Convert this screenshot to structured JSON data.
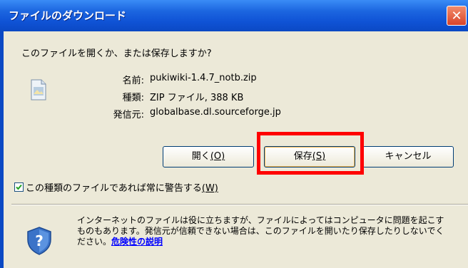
{
  "window": {
    "title": "ファイルのダウンロード",
    "close_symbol": "✕"
  },
  "question": "このファイルを開くか、または保存しますか?",
  "file": {
    "icon": "file-icon",
    "name_label": "名前:",
    "name_value": "pukiwiki-1.4.7_notb.zip",
    "type_label": "種類:",
    "type_value": "ZIP ファイル, 388 KB",
    "from_label": "発信元:",
    "from_value": "globalbase.dl.sourceforge.jp"
  },
  "buttons": {
    "open": {
      "text": "開く",
      "key": "(O)"
    },
    "save": {
      "text": "保存",
      "key": "(S)"
    },
    "cancel": {
      "text": "キャンセル"
    }
  },
  "checkbox": {
    "checked": true,
    "text": "この種類のファイルであれば常に警告する",
    "key": "(W)"
  },
  "warning": {
    "icon": "shield-question-icon",
    "text": "インターネットのファイルは役に立ちますが、ファイルによってはコンピュータに問題を起こすものもあります。発信元が信頼できない場合は、このファイルを開いたり保存したりしないでください。",
    "link": "危険性の説明"
  },
  "colors": {
    "titlebar": "#0f52d5",
    "highlight": "#ff0000",
    "link": "#0000ff",
    "dialog_bg": "#ece9d8"
  }
}
